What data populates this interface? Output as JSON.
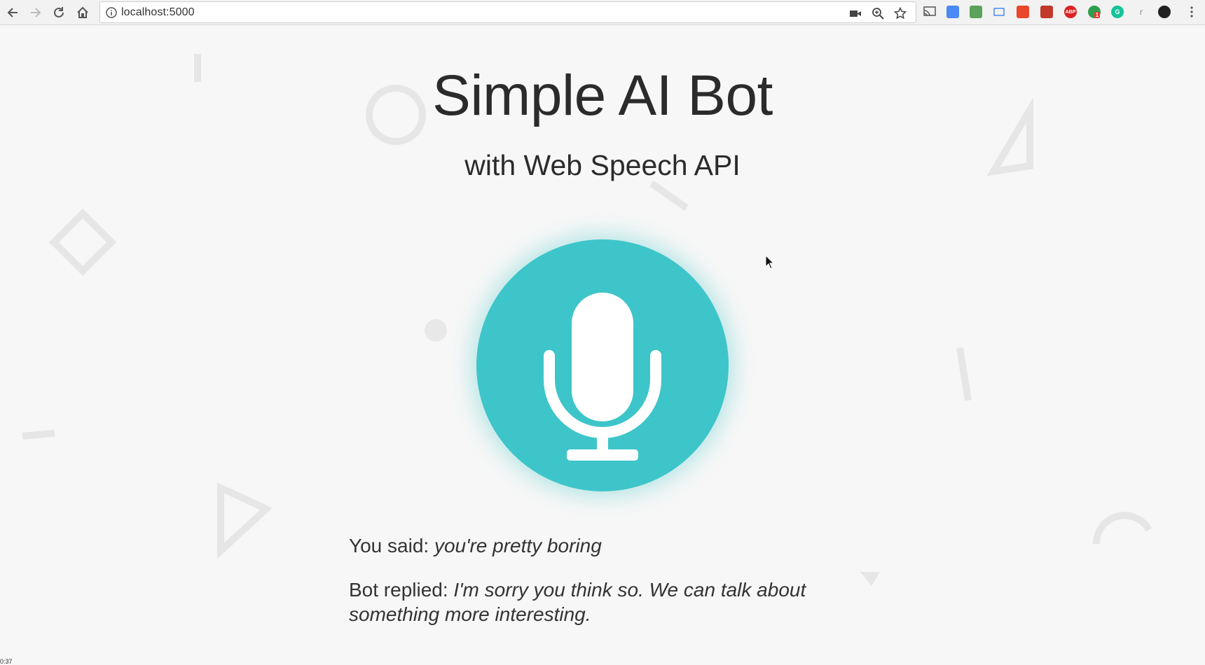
{
  "browser": {
    "url": "localhost:5000",
    "icons": {
      "back": "back-arrow-icon",
      "forward": "forward-arrow-icon",
      "reload": "reload-icon",
      "home": "home-icon",
      "info": "info-icon",
      "camera": "camera-icon",
      "zoom": "zoom-icon",
      "bookmark": "star-icon",
      "menu": "kebab-menu-icon"
    },
    "extensions": [
      {
        "name": "cast",
        "label": ""
      },
      {
        "name": "translate",
        "label": ""
      },
      {
        "name": "evernote",
        "label": ""
      },
      {
        "name": "screenshot",
        "label": ""
      },
      {
        "name": "red-ext",
        "label": ""
      },
      {
        "name": "puzzle",
        "label": ""
      },
      {
        "name": "adblock",
        "label": "ABP"
      },
      {
        "name": "green-ext",
        "label": "1"
      },
      {
        "name": "grammarly",
        "label": "G"
      },
      {
        "name": "r-ext",
        "label": "r"
      },
      {
        "name": "profile",
        "label": ""
      }
    ]
  },
  "page": {
    "title": "Simple AI Bot",
    "subtitle": "with Web Speech API",
    "mic_icon": "microphone-icon",
    "said_label": "You said: ",
    "said_text": "you're pretty boring",
    "replied_label": "Bot replied: ",
    "replied_text": "I'm sorry you think so. We can talk about something more interesting."
  },
  "colors": {
    "accent": "#3ec5c9",
    "background": "#f7f7f7",
    "text": "#2b2b2b"
  },
  "corner_text": "0:37"
}
